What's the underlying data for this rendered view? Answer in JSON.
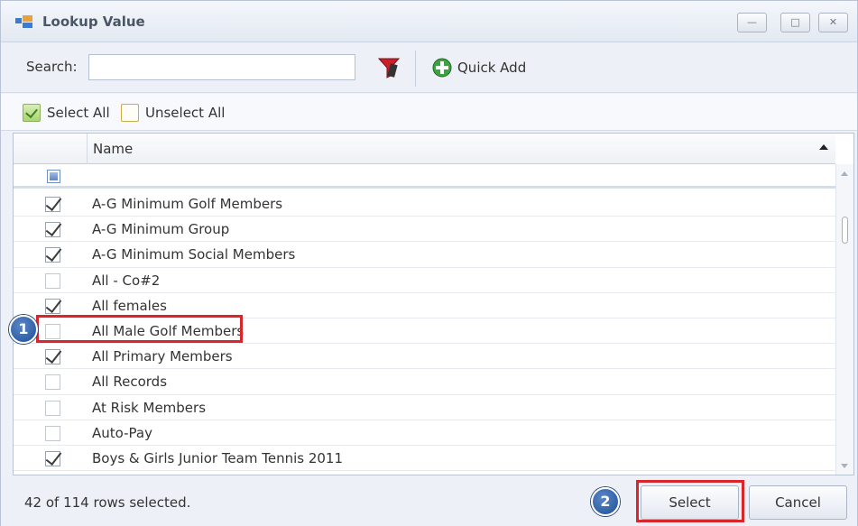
{
  "window": {
    "title": "Lookup Value",
    "controls": {
      "minimize": "—",
      "maximize": "□",
      "close": "✕"
    }
  },
  "toolbar": {
    "search_label": "Search:",
    "search_value": "",
    "filter_icon": "filter-icon",
    "quick_add_label": "Quick Add"
  },
  "selection_bar": {
    "select_all": "Select All",
    "unselect_all": "Unselect All"
  },
  "grid": {
    "column_name": "Name",
    "rows": [
      {
        "name": "A-G Minimum Golf Members",
        "checked": true
      },
      {
        "name": "A-G Minimum Group",
        "checked": true
      },
      {
        "name": "A-G Minimum Social Members",
        "checked": true
      },
      {
        "name": "All - Co#2",
        "checked": false
      },
      {
        "name": "All females",
        "checked": true
      },
      {
        "name": "All Male Golf Members",
        "checked": false
      },
      {
        "name": "All Primary Members",
        "checked": true
      },
      {
        "name": "All Records",
        "checked": false
      },
      {
        "name": "At Risk Members",
        "checked": false
      },
      {
        "name": "Auto-Pay",
        "checked": false
      },
      {
        "name": "Boys & Girls Junior  Team Tennis 2011",
        "checked": true
      },
      {
        "name": "",
        "checked": true
      }
    ]
  },
  "footer": {
    "status": "42 of 114 rows selected.",
    "select_label": "Select",
    "cancel_label": "Cancel"
  },
  "annotations": {
    "step1": "1",
    "step2": "2",
    "color": "#d9262b"
  }
}
